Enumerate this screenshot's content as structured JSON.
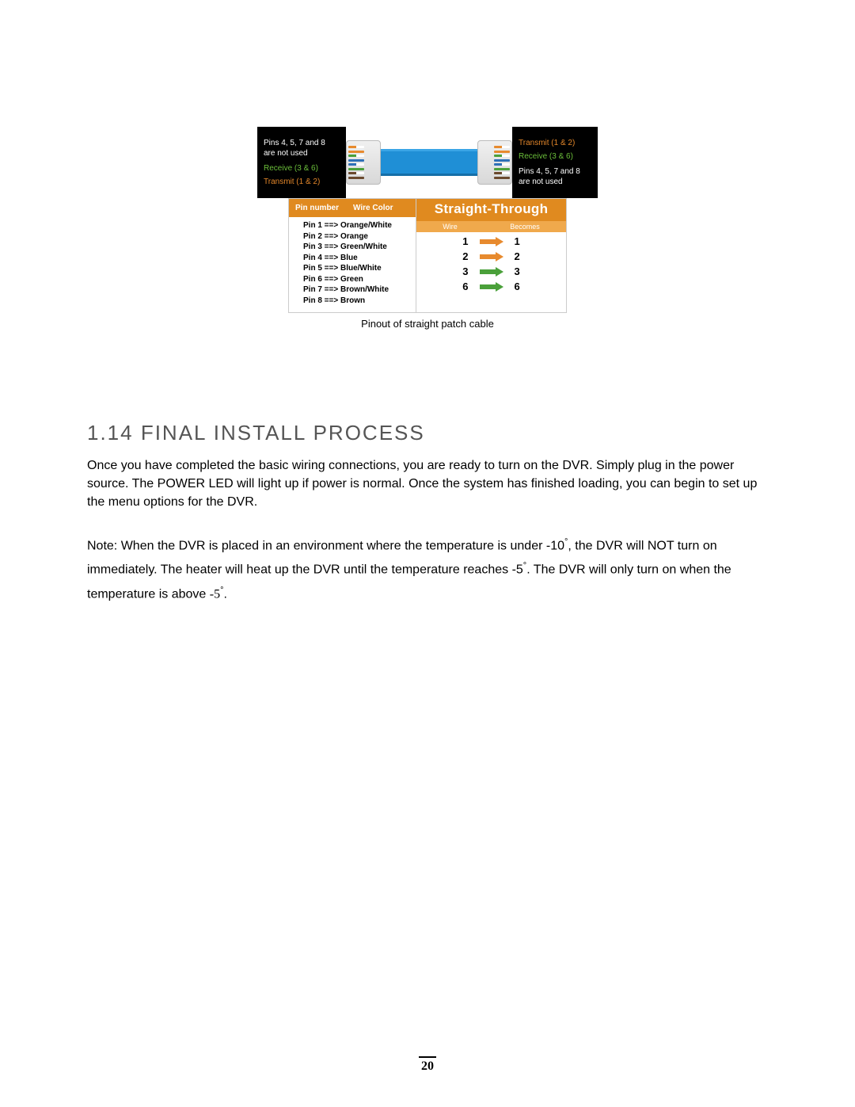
{
  "diagram": {
    "left_box": {
      "line1": "Pins 4, 5, 7 and 8",
      "line2": "are not used",
      "receive": "Receive (3 & 6)",
      "transmit": "Transmit (1 & 2)"
    },
    "right_box": {
      "transmit": "Transmit (1 & 2)",
      "receive": "Receive (3 & 6)",
      "line1": "Pins 4, 5, 7 and 8",
      "line2": "are not used"
    },
    "pin_table": {
      "head_pin": "Pin number",
      "head_color": "Wire Color",
      "rows": [
        "Pin 1 ==> Orange/White",
        "Pin 2 ==> Orange",
        "Pin 3 ==> Green/White",
        "Pin 4 ==> Blue",
        "Pin 5 ==> Blue/White",
        "Pin 6 ==> Green",
        "Pin 7 ==> Brown/White",
        "Pin 8 ==> Brown"
      ]
    },
    "straight": {
      "title": "Straight-Through",
      "head_wire": "Wire",
      "head_becomes": "Becomes",
      "rows": [
        {
          "from": "1",
          "to": "1",
          "color": "orange"
        },
        {
          "from": "2",
          "to": "2",
          "color": "orange"
        },
        {
          "from": "3",
          "to": "3",
          "color": "green"
        },
        {
          "from": "6",
          "to": "6",
          "color": "green"
        }
      ]
    },
    "caption": "Pinout of straight patch cable"
  },
  "section": {
    "heading": "1.14 FINAL INSTALL PROCESS",
    "paragraph": "Once you have completed the basic wiring connections, you are ready to turn on the DVR. Simply plug in the power source. The POWER LED will light up if power is normal. Once the system has finished loading, you can begin to set up the menu options for the DVR."
  },
  "note": {
    "label": "Note:",
    "part1": " When the DVR is placed in an environment where the temperature is under -10",
    "deg1": "°",
    "part2": ", the DVR will ",
    "not": "NOT",
    "part3": " turn on immediately. The heater will heat up the DVR until the temperature reaches -5",
    "deg2": "°",
    "part4": ". The DVR will only turn on when the temperature is above ",
    "minus5": "-5",
    "deg3": "°",
    "part5": "."
  },
  "page_number": "20"
}
